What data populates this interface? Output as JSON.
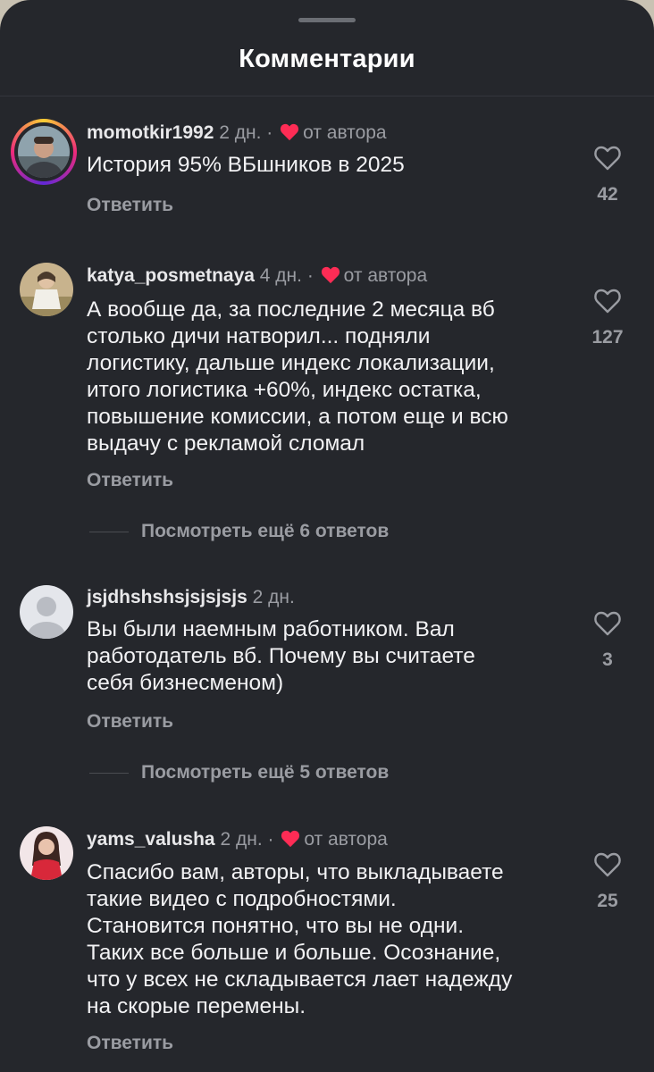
{
  "header": {
    "title": "Комментарии"
  },
  "comments": [
    {
      "username": "momotkir1992",
      "time": "2 дн.",
      "separator": "·",
      "author_badge": "от автора",
      "text": "История 95% ВБшников в 2025",
      "reply_label": "Ответить",
      "likes": "42"
    },
    {
      "username": "katya_posmetnaya",
      "time": "4 дн.",
      "separator": "·",
      "author_badge": "от автора",
      "text_lines": [
        "А вообще да, за последние 2 месяца вб",
        "столько дичи натворил... подняли",
        "логистику, дальше индекс локализации,",
        "итого логистика +60%, индекс остатка,",
        "повышение комиссии, а потом еще и всю",
        "выдачу с рекламой сломал"
      ],
      "reply_label": "Ответить",
      "likes": "127",
      "view_more": "Посмотреть ещё 6 ответов"
    },
    {
      "username": "jsjdhshshsjsjsjsjs",
      "time": "2 дн.",
      "text_lines": [
        "Вы были наемным работником. Вал",
        "работодатель вб. Почему вы считаете",
        "себя бизнесменом)"
      ],
      "reply_label": "Ответить",
      "likes": "3",
      "view_more": "Посмотреть ещё 5 ответов"
    },
    {
      "username": "yams_valusha",
      "time": "2 дн.",
      "separator": "·",
      "author_badge": "от автора",
      "text_lines": [
        "Спасибо вам, авторы, что выкладываете",
        "такие видео с подробностями.",
        "Становится понятно, что вы не одни.",
        "Таких все больше и больше. Осознание,",
        "что у всех не складывается лает надежду",
        "на скорые перемены."
      ],
      "reply_label": "Ответить",
      "likes": "25"
    }
  ],
  "colors": {
    "background": "#25272c",
    "author_heart": "#fe2c55",
    "muted_text": "#9a9ca2",
    "primary_text": "#f2f2f4"
  }
}
